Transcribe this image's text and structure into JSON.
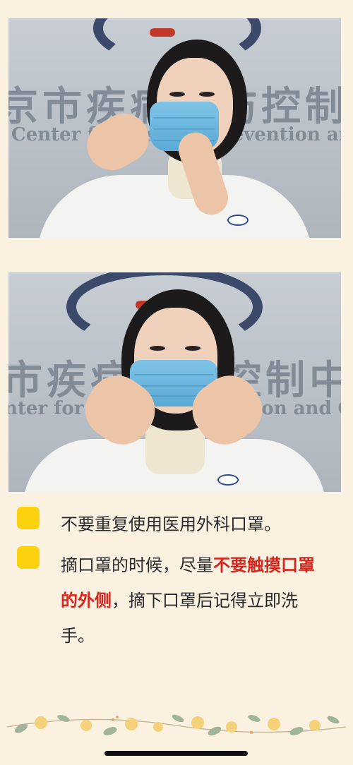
{
  "photos": [
    {
      "sign_cn": "京市疾病预防控制中",
      "sign_en": "Center for Disease Prevention and Control",
      "alt": "Pressing mask nose clip"
    },
    {
      "sign_cn": "市疾病预防控制中",
      "sign_en": "nter for Disease Prevention and Co",
      "alt": "Fitting mask to nose bridge"
    }
  ],
  "tips": [
    {
      "text_plain": "不要重复使用医用外科口罩。"
    },
    {
      "text_before": "摘口罩的时候，尽量",
      "text_highlight": "不要触摸口罩的外侧",
      "text_after": "，摘下口罩后记得立即洗手。"
    }
  ],
  "colors": {
    "background": "#faf1e1",
    "bullet": "#fcd20f",
    "highlight": "#d7261e",
    "mask": "#6cb6de"
  }
}
